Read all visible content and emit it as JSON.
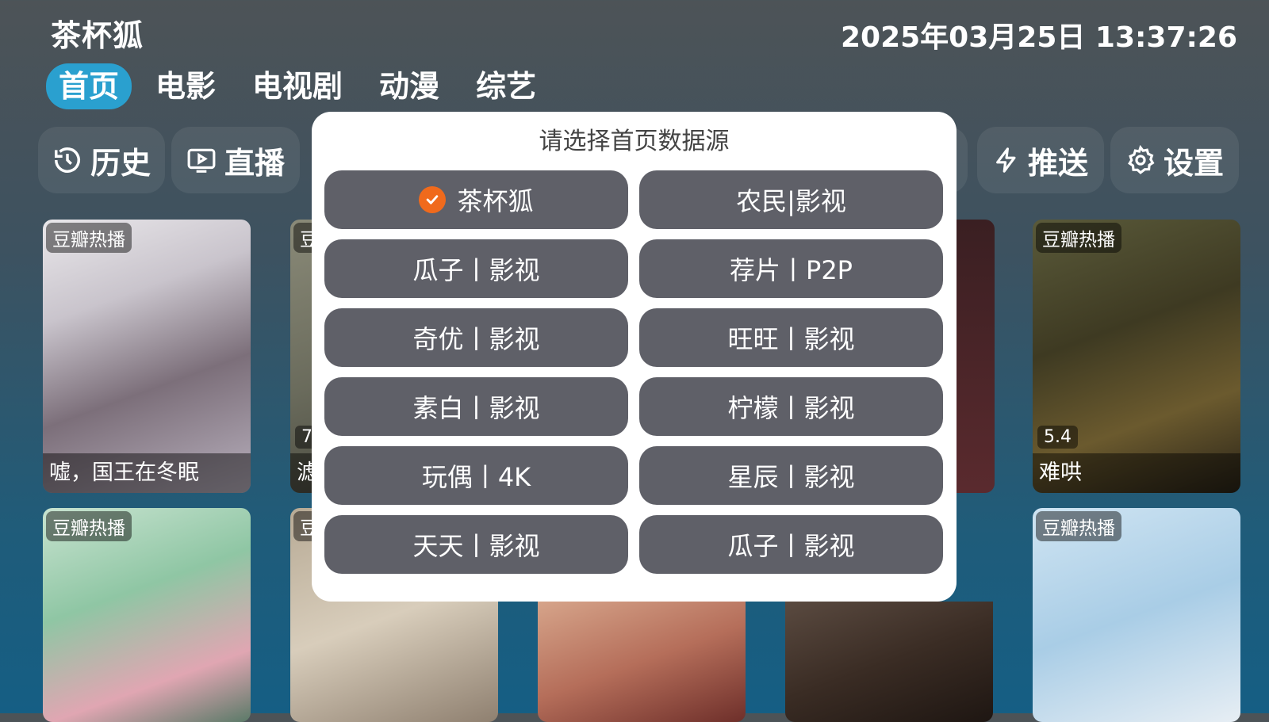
{
  "app_title": "茶杯狐",
  "datetime": "2025年03月25日 13:37:26",
  "nav": [
    "首页",
    "电影",
    "电视剧",
    "动漫",
    "综艺"
  ],
  "quick_actions": {
    "history": "历史",
    "live": "直播",
    "push": "推送",
    "settings": "设置"
  },
  "cards_row1": [
    {
      "badge": "豆瓣热播",
      "title": "嘘，国王在冬眠",
      "score": ""
    },
    {
      "badge": "豆",
      "title": "滤",
      "score": "7."
    },
    {
      "badge": "豆瓣热播",
      "title": "难哄",
      "score": "5.4"
    }
  ],
  "cards_row2": [
    {
      "badge": "豆瓣热播"
    },
    {
      "badge": "豆"
    },
    {
      "badge": "豆瓣热播"
    }
  ],
  "dialog": {
    "title": "请选择首页数据源",
    "options": [
      {
        "label": "茶杯狐",
        "selected": true
      },
      {
        "label": "农民|影视",
        "selected": false
      },
      {
        "label": "瓜子丨影视",
        "selected": false
      },
      {
        "label": "荐片丨P2P",
        "selected": false
      },
      {
        "label": "奇优丨影视",
        "selected": false
      },
      {
        "label": "旺旺丨影视",
        "selected": false
      },
      {
        "label": "素白丨影视",
        "selected": false
      },
      {
        "label": "柠檬丨影视",
        "selected": false
      },
      {
        "label": "玩偶丨4K",
        "selected": false
      },
      {
        "label": "星辰丨影视",
        "selected": false
      },
      {
        "label": "天天丨影视",
        "selected": false
      },
      {
        "label": "瓜子丨影视",
        "selected": false
      }
    ]
  },
  "colors": {
    "accent": "#2aa0cf",
    "option_bg": "#5f6068",
    "check": "#f06a1c"
  }
}
